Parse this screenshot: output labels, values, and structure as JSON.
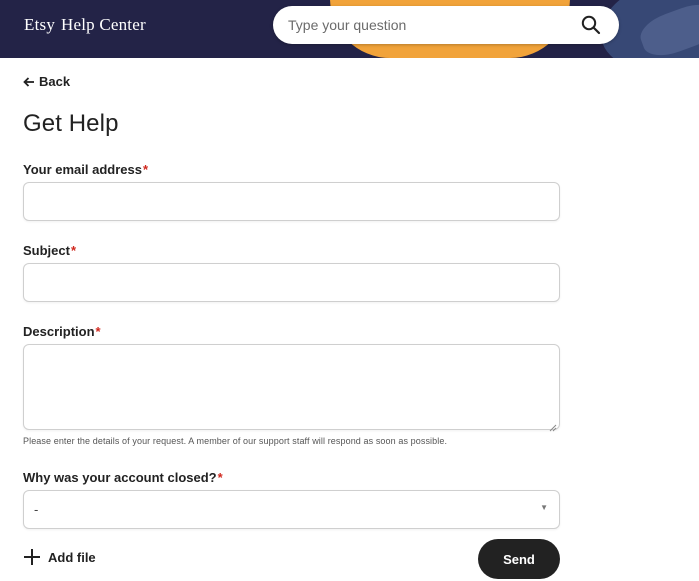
{
  "header": {
    "logo_brand": "Etsy",
    "logo_suffix": "Help Center",
    "search_placeholder": "Type your question",
    "search_icon": "search-icon"
  },
  "nav": {
    "back_label": "Back"
  },
  "page": {
    "title": "Get Help"
  },
  "form": {
    "required_mark": "*",
    "email": {
      "label": "Your email address",
      "value": ""
    },
    "subject": {
      "label": "Subject",
      "value": ""
    },
    "description": {
      "label": "Description",
      "value": "",
      "helper": "Please enter the details of your request. A member of our support staff will respond as soon as possible."
    },
    "reason": {
      "label": "Why was your account closed?",
      "selected": "-"
    },
    "add_file_label": "Add file",
    "send_label": "Send"
  },
  "colors": {
    "header_bg": "#232347",
    "accent_orange": "#f1a33a",
    "required": "#d0271d",
    "button_bg": "#222222"
  }
}
